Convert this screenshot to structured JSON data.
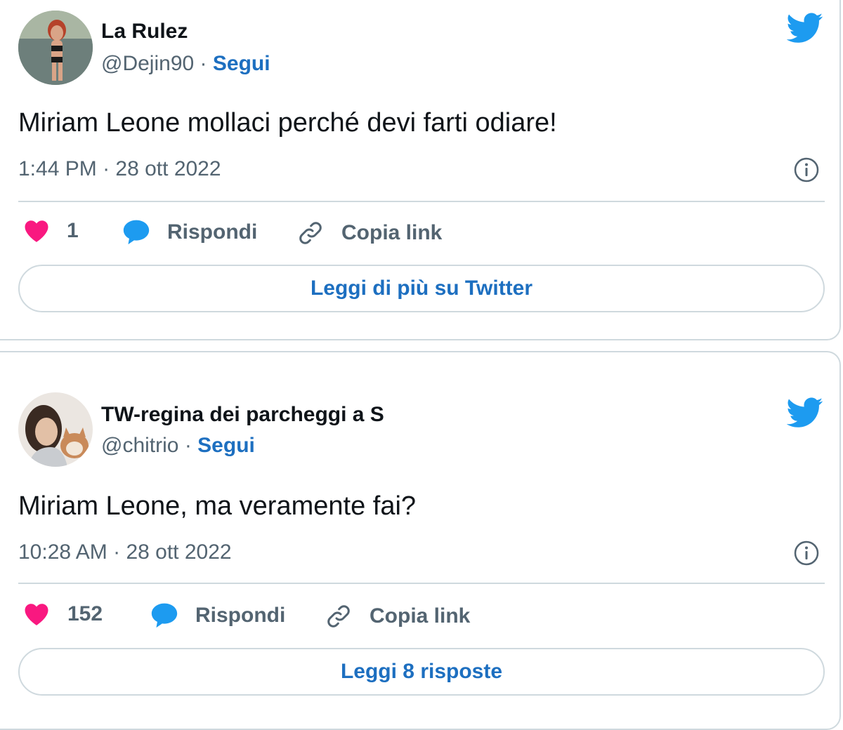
{
  "colors": {
    "accent": "#1d6fc0",
    "twitter_blue": "#1d9bf0",
    "heart_pink": "#f91880",
    "muted_text": "#536471",
    "border": "#cfd9de"
  },
  "tweets": [
    {
      "display_name": "La Rulez",
      "handle": "@Dejin90",
      "separator": "·",
      "follow_label": "Segui",
      "text": "Miriam Leone mollaci perché devi farti odiare!",
      "time": "1:44 PM",
      "date": "28 ott 2022",
      "likes": "1",
      "reply_label": "Rispondi",
      "copy_label": "Copia link",
      "cta_label": "Leggi di più su Twitter",
      "icons": [
        "heart-icon",
        "reply-bubble-icon",
        "link-icon",
        "twitter-bird-icon",
        "info-icon"
      ]
    },
    {
      "display_name": "TW-regina dei parcheggi a S",
      "handle": "@chitrio",
      "separator": "·",
      "follow_label": "Segui",
      "text": "Miriam Leone, ma veramente fai?",
      "time": "10:28 AM",
      "date": "28 ott 2022",
      "likes": "152",
      "reply_label": "Rispondi",
      "copy_label": "Copia link",
      "cta_label": "Leggi 8 risposte",
      "icons": [
        "heart-icon",
        "reply-bubble-icon",
        "link-icon",
        "twitter-bird-icon",
        "info-icon"
      ]
    }
  ]
}
